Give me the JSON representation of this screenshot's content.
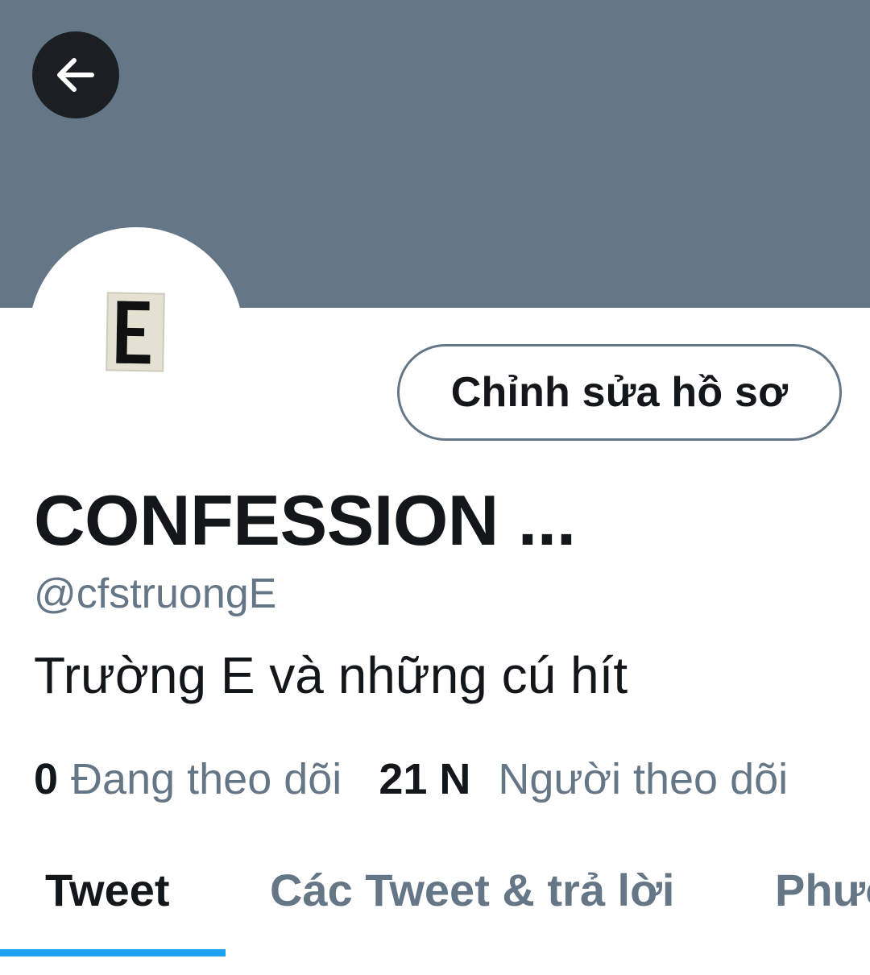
{
  "profile": {
    "display_name": "CONFESSION ...",
    "handle": "@cfstruongE",
    "bio": "Trường E và những cú hít",
    "avatar_letter": "E",
    "edit_button_label": "Chỉnh sửa hồ sơ"
  },
  "stats": {
    "following_count": "0",
    "following_label": "Đang theo dõi",
    "followers_count": "21 N",
    "followers_label": "Người theo dõi"
  },
  "tabs": [
    {
      "label": "Tweet",
      "active": true
    },
    {
      "label": "Các Tweet & trả lời",
      "active": false
    },
    {
      "label": "Phương tiện",
      "active": false
    }
  ],
  "colors": {
    "banner": "#657786",
    "accent": "#1da1f2",
    "text_primary": "#14171a",
    "text_secondary": "#657786"
  },
  "icons": {
    "back": "arrow-left-icon"
  }
}
